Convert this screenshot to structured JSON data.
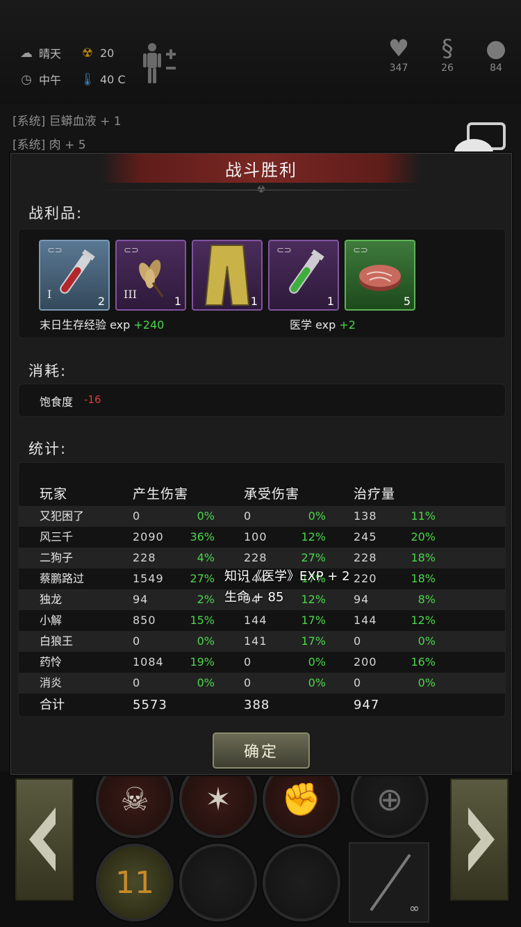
{
  "status": {
    "weather": "晴天",
    "radiation": "20",
    "time_of_day": "中午",
    "temperature": "40 C",
    "health": "347",
    "hunger": "26",
    "mind": "84"
  },
  "log": [
    "[系统] 巨蟒血液 + 1",
    "[系统] 肉 + 5"
  ],
  "dialog": {
    "title": "战斗胜利",
    "loot_label": "战利品:",
    "loot_items": [
      {
        "name": "blood-vial",
        "tier": "I",
        "qty": "2",
        "rarity": "blue"
      },
      {
        "name": "herb-bundle",
        "tier": "III",
        "qty": "1",
        "rarity": "purple"
      },
      {
        "name": "yellow-pants",
        "tier": "",
        "qty": "1",
        "rarity": "purple"
      },
      {
        "name": "green-vial",
        "tier": "",
        "qty": "1",
        "rarity": "purple"
      },
      {
        "name": "raw-meat",
        "tier": "",
        "qty": "5",
        "rarity": "green"
      }
    ],
    "exp_survival_label": "末日生存经验 exp",
    "exp_survival_value": "+240",
    "exp_medicine_label": "医学 exp",
    "exp_medicine_value": "+2",
    "cost_label": "消耗:",
    "cost_name": "饱食度",
    "cost_value": "-16",
    "stats_label": "统计:",
    "headers": [
      "玩家",
      "产生伤害",
      "承受伤害",
      "治疗量"
    ],
    "rows": [
      {
        "player": "又犯困了",
        "dmg": "0",
        "dmg_pct": "0%",
        "taken": "0",
        "taken_pct": "0%",
        "heal": "138",
        "heal_pct": "11%"
      },
      {
        "player": "风三千",
        "dmg": "2090",
        "dmg_pct": "36%",
        "taken": "100",
        "taken_pct": "12%",
        "heal": "245",
        "heal_pct": "20%"
      },
      {
        "player": "二狗子",
        "dmg": "228",
        "dmg_pct": "4%",
        "taken": "228",
        "taken_pct": "27%",
        "heal": "228",
        "heal_pct": "18%"
      },
      {
        "player": "蔡鹏路过",
        "dmg": "1549",
        "dmg_pct": "27%",
        "taken": "144",
        "taken_pct": "17%",
        "heal": "220",
        "heal_pct": "18%"
      },
      {
        "player": "独龙",
        "dmg": "94",
        "dmg_pct": "2%",
        "taken": "94",
        "taken_pct": "12%",
        "heal": "94",
        "heal_pct": "8%"
      },
      {
        "player": "小解",
        "dmg": "850",
        "dmg_pct": "15%",
        "taken": "144",
        "taken_pct": "17%",
        "heal": "144",
        "heal_pct": "12%"
      },
      {
        "player": "白狼王",
        "dmg": "0",
        "dmg_pct": "0%",
        "taken": "141",
        "taken_pct": "17%",
        "heal": "0",
        "heal_pct": "0%"
      },
      {
        "player": "药怜",
        "dmg": "1084",
        "dmg_pct": "19%",
        "taken": "0",
        "taken_pct": "0%",
        "heal": "200",
        "heal_pct": "16%"
      },
      {
        "player": "消炎",
        "dmg": "0",
        "dmg_pct": "0%",
        "taken": "0",
        "taken_pct": "0%",
        "heal": "0",
        "heal_pct": "0%"
      }
    ],
    "total_label": "合计",
    "total_dmg": "5573",
    "total_taken": "388",
    "total_heal": "947",
    "confirm_label": "确定"
  },
  "floating_messages": [
    "知识《医学》EXP + 2",
    "生命 + 85"
  ],
  "bottom": {
    "counter": "11",
    "infinity": "∞"
  },
  "colors": {
    "positive": "#4bd64b",
    "negative": "#e03a3a",
    "banner": "#7a2723"
  }
}
